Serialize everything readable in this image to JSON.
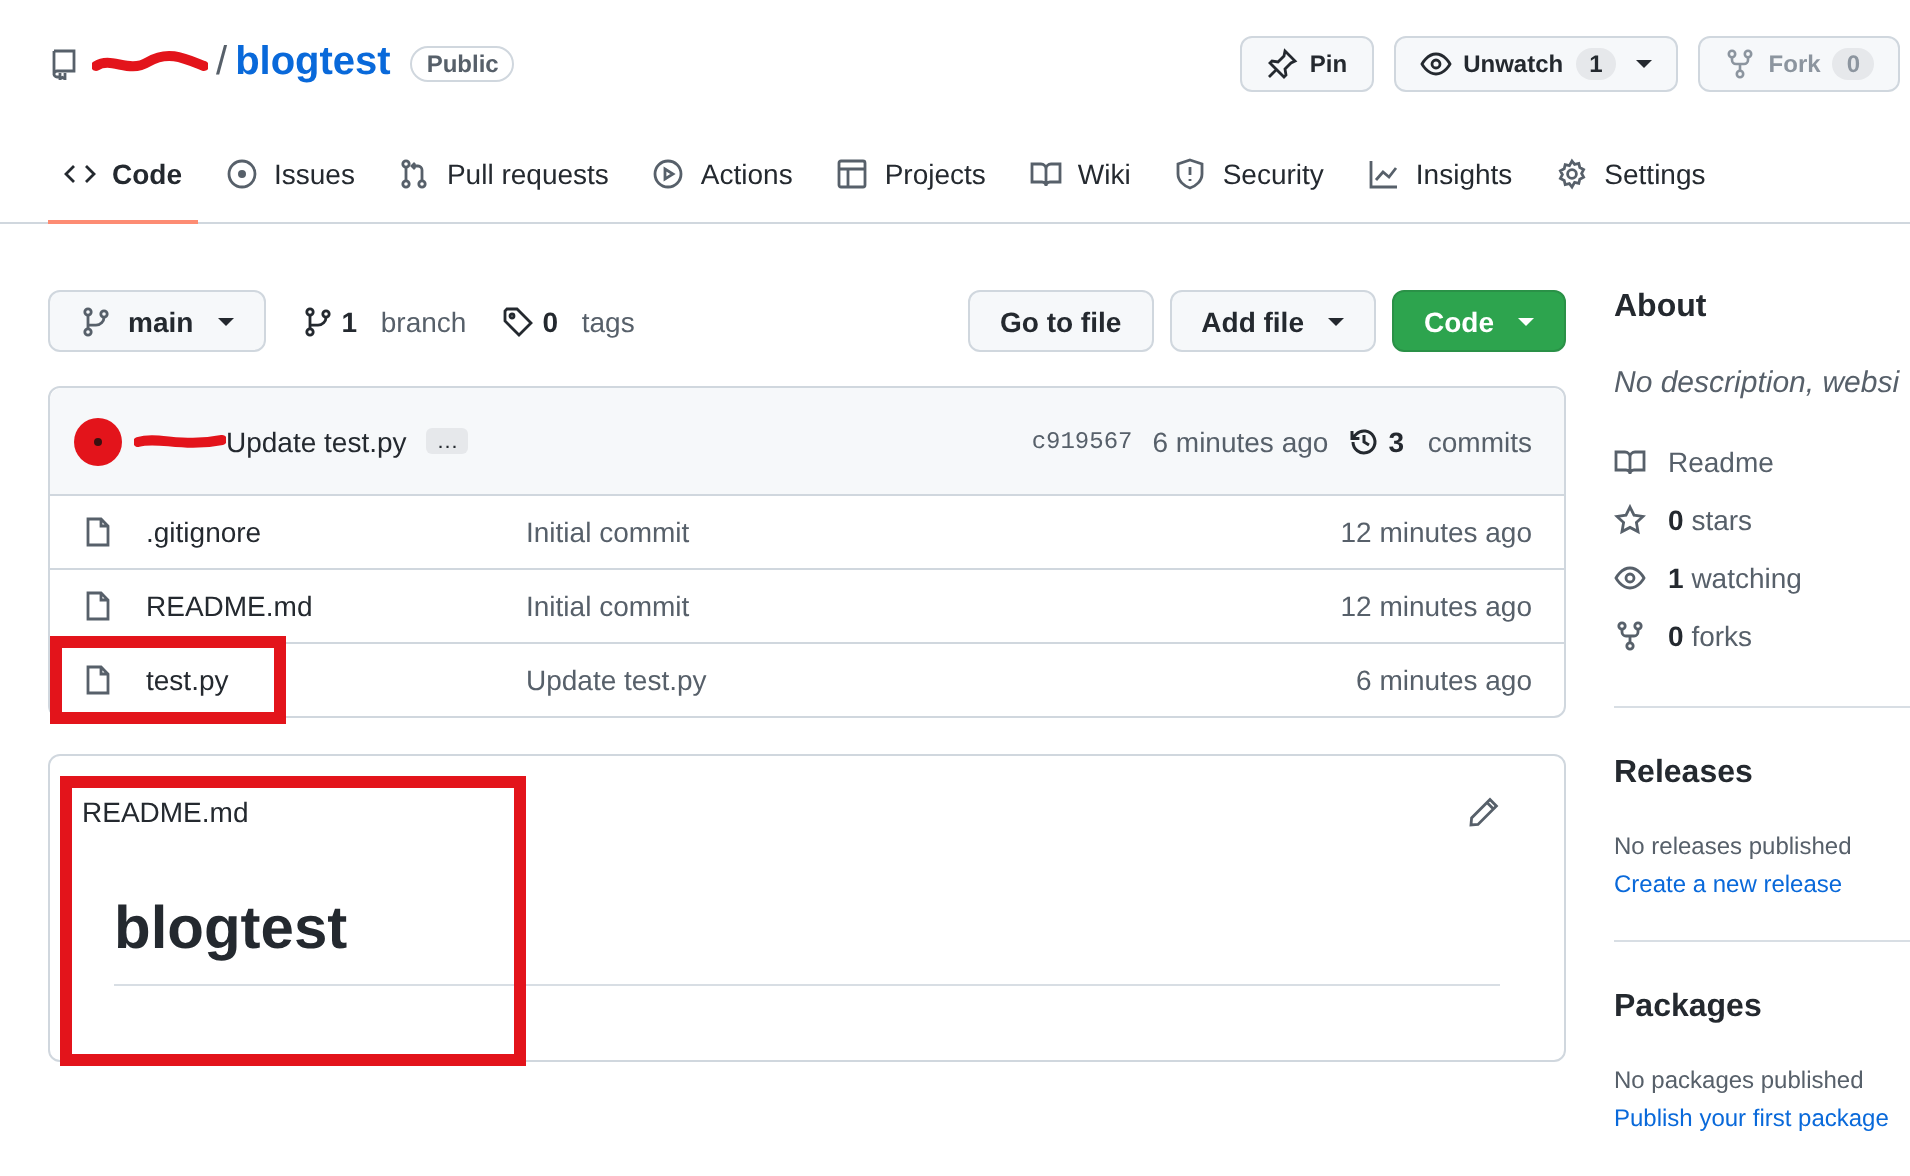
{
  "repo": {
    "separator": "/",
    "name": "blogtest",
    "visibility": "Public"
  },
  "header_buttons": [
    {
      "kind": "pin",
      "label": "Pin",
      "disabled": false
    },
    {
      "kind": "watch",
      "label": "Unwatch",
      "count": "1",
      "dropdown": true,
      "disabled": false
    },
    {
      "kind": "fork",
      "label": "Fork",
      "count": "0",
      "disabled": true
    }
  ],
  "tabs": [
    {
      "kind": "code",
      "label": "Code",
      "selected": true
    },
    {
      "kind": "issues",
      "label": "Issues",
      "selected": false
    },
    {
      "kind": "pulls",
      "label": "Pull requests",
      "selected": false
    },
    {
      "kind": "actions",
      "label": "Actions",
      "selected": false
    },
    {
      "kind": "projects",
      "label": "Projects",
      "selected": false
    },
    {
      "kind": "wiki",
      "label": "Wiki",
      "selected": false
    },
    {
      "kind": "security",
      "label": "Security",
      "selected": false
    },
    {
      "kind": "insights",
      "label": "Insights",
      "selected": false
    },
    {
      "kind": "settings",
      "label": "Settings",
      "selected": false
    }
  ],
  "branch_bar": {
    "branch": "main",
    "branch_count": "1",
    "branch_label": "branch",
    "tag_count": "0",
    "tag_label": "tags"
  },
  "file_actions": [
    {
      "label": "Go to file",
      "kind": "plain",
      "dropdown": false
    },
    {
      "label": "Add file",
      "kind": "plain",
      "dropdown": true
    },
    {
      "label": "Code",
      "kind": "primary",
      "dropdown": true
    }
  ],
  "latest_commit": {
    "message": "Update test.py",
    "ellipsis": "…",
    "hash": "c919567",
    "time": "6 minutes ago",
    "commit_count": "3",
    "commit_label": "commits"
  },
  "files": [
    {
      "name": ".gitignore",
      "message": "Initial commit",
      "time": "12 minutes ago",
      "annotated": false
    },
    {
      "name": "README.md",
      "message": "Initial commit",
      "time": "12 minutes ago",
      "annotated": false
    },
    {
      "name": "test.py",
      "message": "Update test.py",
      "time": "6 minutes ago",
      "annotated": true
    }
  ],
  "readme": {
    "title": "README.md",
    "heading": "blogtest",
    "annotated": true
  },
  "about": {
    "heading": "About",
    "description": "No description, websi",
    "items": [
      {
        "kind": "readme",
        "text": "Readme"
      },
      {
        "kind": "star",
        "count": "0",
        "text": "stars"
      },
      {
        "kind": "eye",
        "count": "1",
        "text": "watching"
      },
      {
        "kind": "fork",
        "count": "0",
        "text": "forks"
      }
    ]
  },
  "releases": {
    "heading": "Releases",
    "text": "No releases published",
    "link": "Create a new release"
  },
  "packages": {
    "heading": "Packages",
    "text": "No packages published",
    "link": "Publish your first package"
  }
}
